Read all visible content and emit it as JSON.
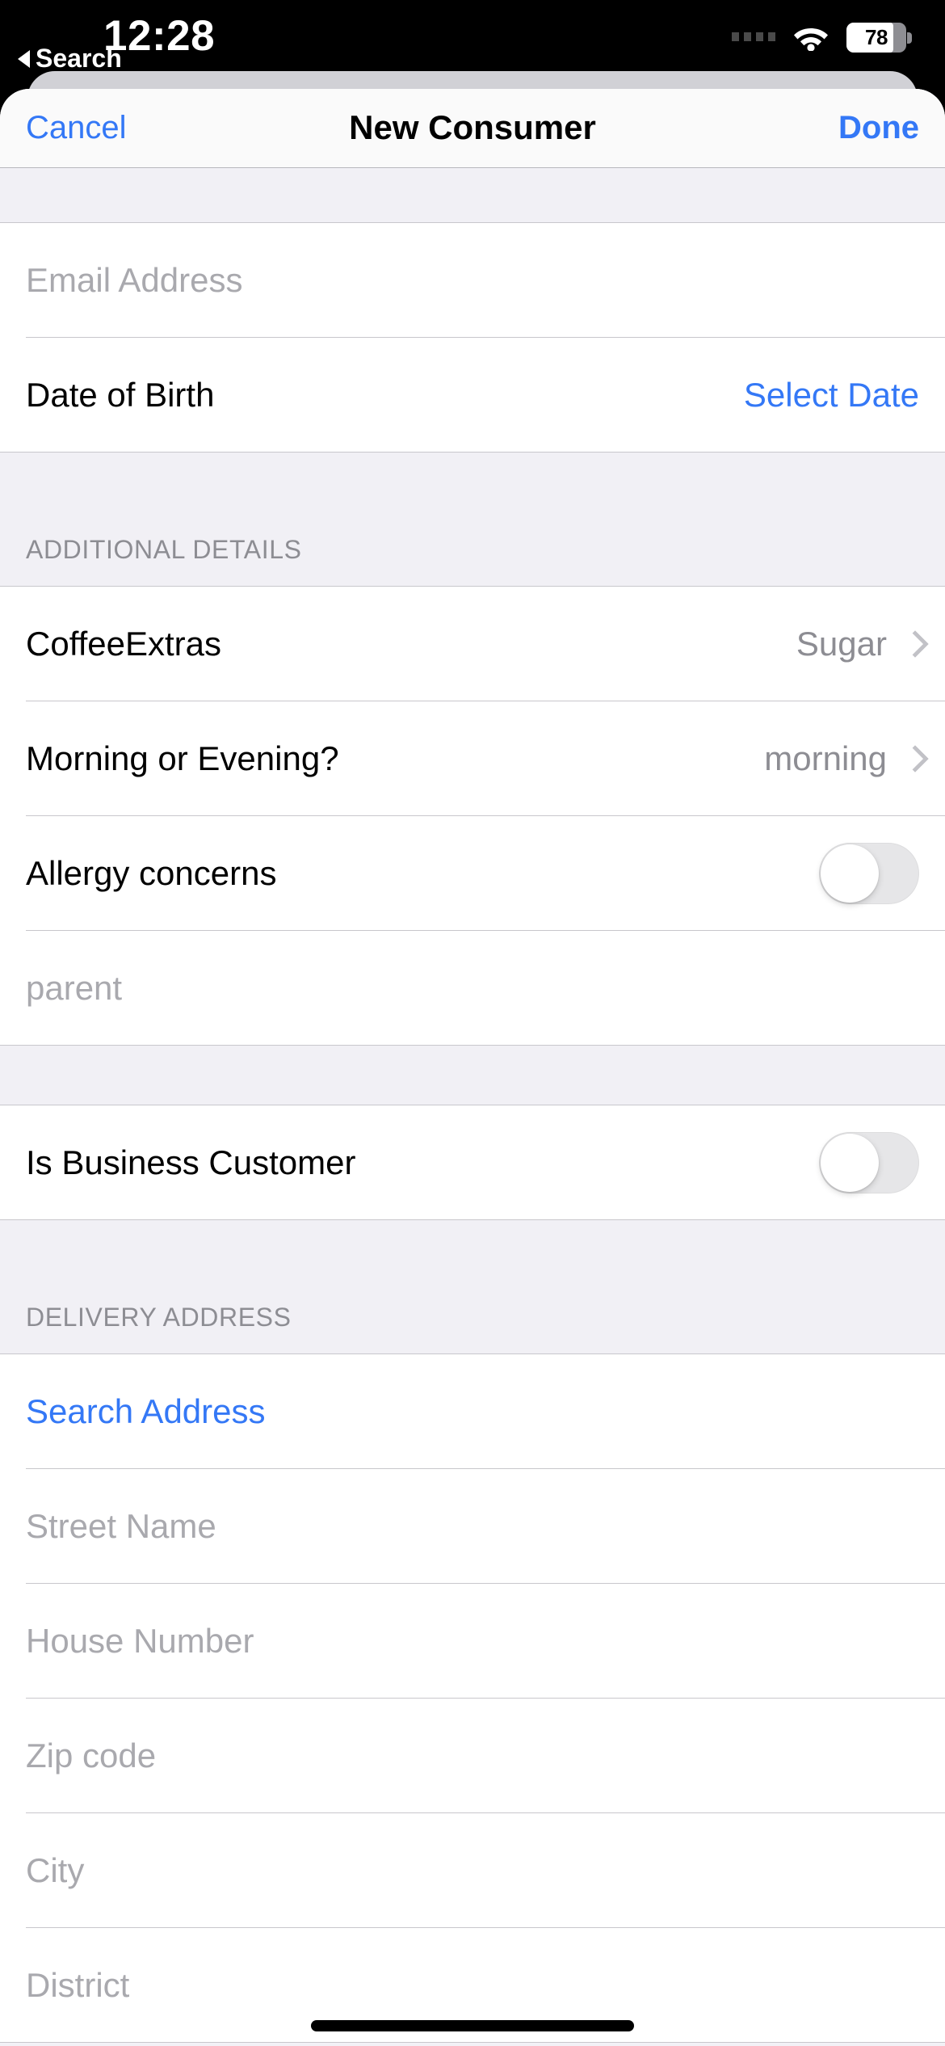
{
  "status_bar": {
    "time": "12:28",
    "battery_percent": "78",
    "battery_level": 78,
    "wifi_icon": "wifi-icon",
    "dots_icon": "signal-dots-icon"
  },
  "back_to_app": {
    "label": "Search",
    "icon": "back-triangle-icon"
  },
  "navbar": {
    "cancel_label": "Cancel",
    "title": "New Consumer",
    "done_label": "Done"
  },
  "colors": {
    "accent": "#3478f6",
    "group_bg": "#ffffff",
    "page_bg": "#f1f0f5",
    "separator": "#c8c7cc",
    "placeholder": "#a9a9ae",
    "secondary_text": "#8d8d93"
  },
  "sections": [
    {
      "header": "",
      "rows": [
        {
          "type": "input",
          "placeholder": "Email Address",
          "value": "",
          "name": "email-field"
        },
        {
          "type": "disclosure_value",
          "label": "Date of Birth",
          "value": "Select Date",
          "value_accent": true,
          "chevron": false,
          "name": "date-of-birth-row"
        }
      ]
    },
    {
      "header": "ADDITIONAL DETAILS",
      "rows": [
        {
          "type": "disclosure_value",
          "label": "CoffeeExtras",
          "value": "Sugar",
          "value_accent": false,
          "chevron": true,
          "name": "coffee-extras-row"
        },
        {
          "type": "disclosure_value",
          "label": "Morning or Evening?",
          "value": "morning",
          "value_accent": false,
          "chevron": true,
          "name": "morning-or-evening-row"
        },
        {
          "type": "toggle",
          "label": "Allergy concerns",
          "on": false,
          "name": "allergy-concerns-row"
        },
        {
          "type": "input",
          "placeholder": "parent",
          "value": "",
          "name": "parent-field"
        }
      ]
    },
    {
      "header": "",
      "rows": [
        {
          "type": "toggle",
          "label": "Is Business Customer",
          "on": false,
          "name": "is-business-customer-row"
        }
      ]
    },
    {
      "header": "DELIVERY ADDRESS",
      "rows": [
        {
          "type": "action",
          "label": "Search Address",
          "name": "search-address-row"
        },
        {
          "type": "input",
          "placeholder": "Street Name",
          "value": "",
          "name": "street-name-field"
        },
        {
          "type": "input",
          "placeholder": "House Number",
          "value": "",
          "name": "house-number-field"
        },
        {
          "type": "input",
          "placeholder": "Zip code",
          "value": "",
          "name": "zip-code-field"
        },
        {
          "type": "input",
          "placeholder": "City",
          "value": "",
          "name": "city-field"
        },
        {
          "type": "input",
          "placeholder": "District",
          "value": "",
          "name": "district-field"
        }
      ]
    }
  ]
}
